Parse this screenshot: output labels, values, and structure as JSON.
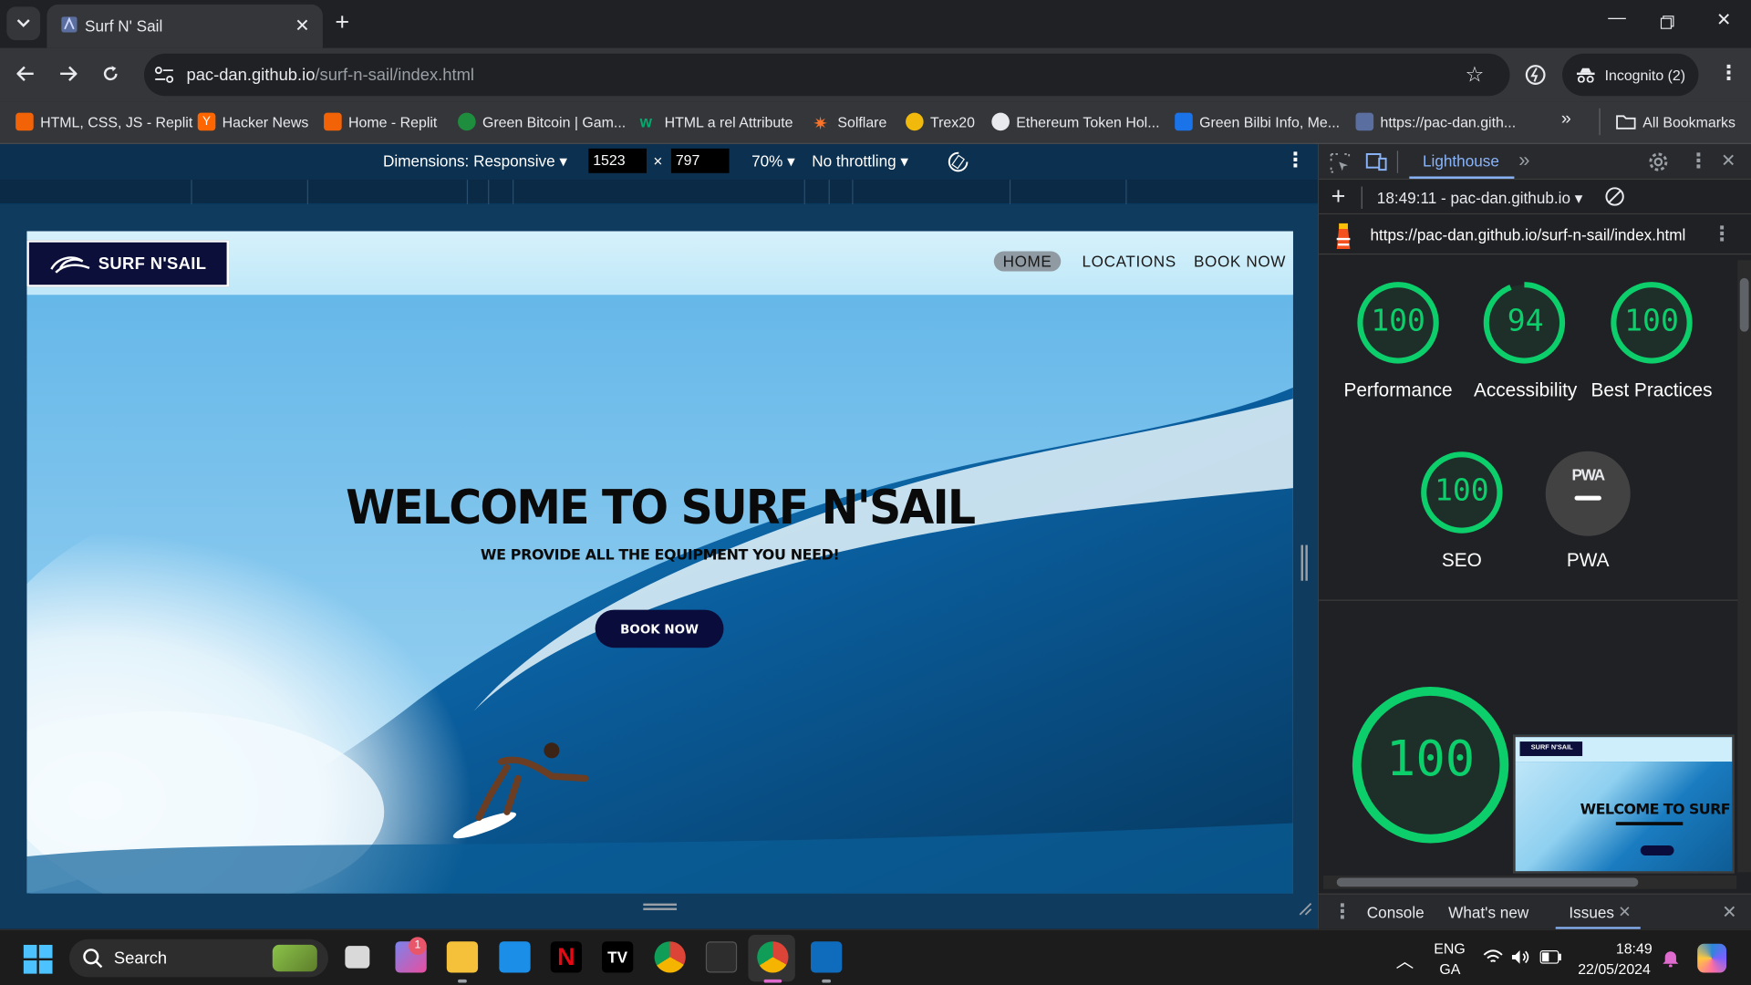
{
  "browser": {
    "tab_title": "Surf N' Sail",
    "url_host": "pac-dan.github.io",
    "url_path": "/surf-n-sail/index.html",
    "incognito_label": "Incognito (2)"
  },
  "bookmarks": [
    {
      "label": "HTML, CSS, JS - Replit",
      "icon": "replit-icon",
      "color": "#f26207"
    },
    {
      "label": "Hacker News",
      "icon": "hacker-news-icon",
      "color": "#ff6600"
    },
    {
      "label": "Home - Replit",
      "icon": "replit-icon",
      "color": "#f26207"
    },
    {
      "label": "Green Bitcoin | Gam...",
      "icon": "green-bitcoin-icon",
      "color": "#1e8e3e"
    },
    {
      "label": "HTML a rel Attribute",
      "icon": "w3schools-icon",
      "color": "#04aa6d"
    },
    {
      "label": "Solflare",
      "icon": "solflare-icon",
      "color": "#fc7227"
    },
    {
      "label": "Trex20",
      "icon": "trex-icon",
      "color": "#f0b90b"
    },
    {
      "label": "Ethereum Token Hol...",
      "icon": "etherscan-icon",
      "color": "#e8eaed"
    },
    {
      "label": "Green Bilbi Info, Me...",
      "icon": "bilbi-icon",
      "color": "#1a73e8"
    },
    {
      "label": "https://pac-dan.gith...",
      "icon": "site-icon",
      "color": "#9aa0a6"
    }
  ],
  "all_bookmarks_label": "All Bookmarks",
  "device_toolbar": {
    "dimensions_label": "Dimensions: Responsive",
    "width": "1523",
    "times": "×",
    "height": "797",
    "zoom": "70%",
    "throttling": "No throttling"
  },
  "site": {
    "logo_text": "SURF N'SAIL",
    "nav": {
      "home": "HOME",
      "locations": "LOCATIONS",
      "book_now": "BOOK NOW"
    },
    "hero_title": "WELCOME TO SURF N'SAIL",
    "hero_subtitle": "WE PROVIDE ALL THE EQUIPMENT YOU NEED!",
    "hero_button": "BOOK NOW"
  },
  "devtools": {
    "active_tab": "Lighthouse",
    "report_time": "18:49:11 - pac-dan.github.io",
    "report_url": "https://pac-dan.github.io/surf-n-sail/index.html",
    "scores": [
      {
        "value": "100",
        "score": 1.0,
        "label": "Performance"
      },
      {
        "value": "94",
        "score": 0.94,
        "label": "Accessibility"
      },
      {
        "value": "100",
        "score": 1.0,
        "label": "Best Practices"
      },
      {
        "value": "100",
        "score": 1.0,
        "label": "SEO"
      },
      {
        "label": "PWA",
        "badge": "PWA"
      }
    ],
    "big_score": "100",
    "thumb_title": "WELCOME TO SURF N",
    "thumb_logo": "SURF N'SAIL",
    "drawer_tabs": {
      "console": "Console",
      "whats_new": "What's new",
      "issues": "Issues"
    },
    "score_color": "#0cce6b"
  },
  "taskbar": {
    "search_placeholder": "Search",
    "lang_top": "ENG",
    "lang_bottom": "GA",
    "time": "18:49",
    "date": "22/05/2024",
    "teams_badge": "1"
  }
}
